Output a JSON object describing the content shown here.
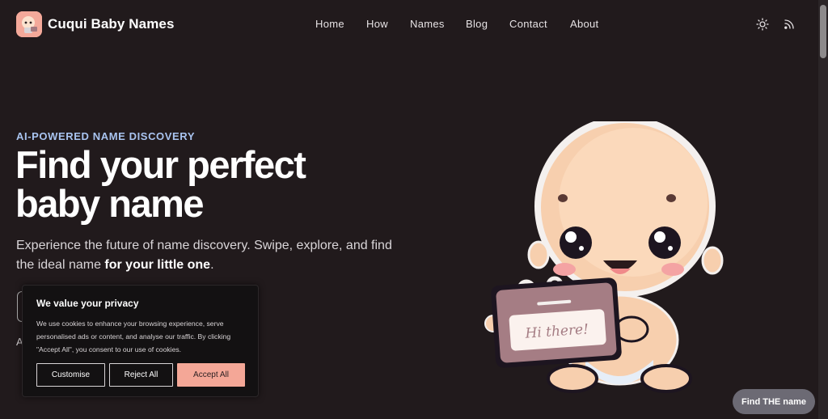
{
  "header": {
    "brand": "Cuqui Baby Names",
    "nav": [
      "Home",
      "How",
      "Names",
      "Blog",
      "Contact",
      "About"
    ],
    "icons": [
      "sun-icon",
      "rss-icon"
    ]
  },
  "hero": {
    "eyebrow": "AI-POWERED NAME DISCOVERY",
    "headline_line1": "Find your perfect",
    "headline_line2": "baby name",
    "subtitle_plain": "Experience the future of name discovery. Swipe, explore, and find the ideal name ",
    "subtitle_bold": "for your little one",
    "subtitle_end": ".",
    "partial_text": "A"
  },
  "illustration": {
    "sign_text": "Hi there!"
  },
  "cookie": {
    "title": "We value your privacy",
    "body": "We use cookies to enhance your browsing experience, serve personalised ads or content, and analyse our traffic. By clicking \"Accept All\", you consent to our use of cookies.",
    "customise": "Customise",
    "reject": "Reject All",
    "accept": "Accept All"
  },
  "find_button": "Find THE name",
  "colors": {
    "background": "#211a1c",
    "accent": "#f4a797",
    "eyebrow": "#a9c4f0"
  }
}
